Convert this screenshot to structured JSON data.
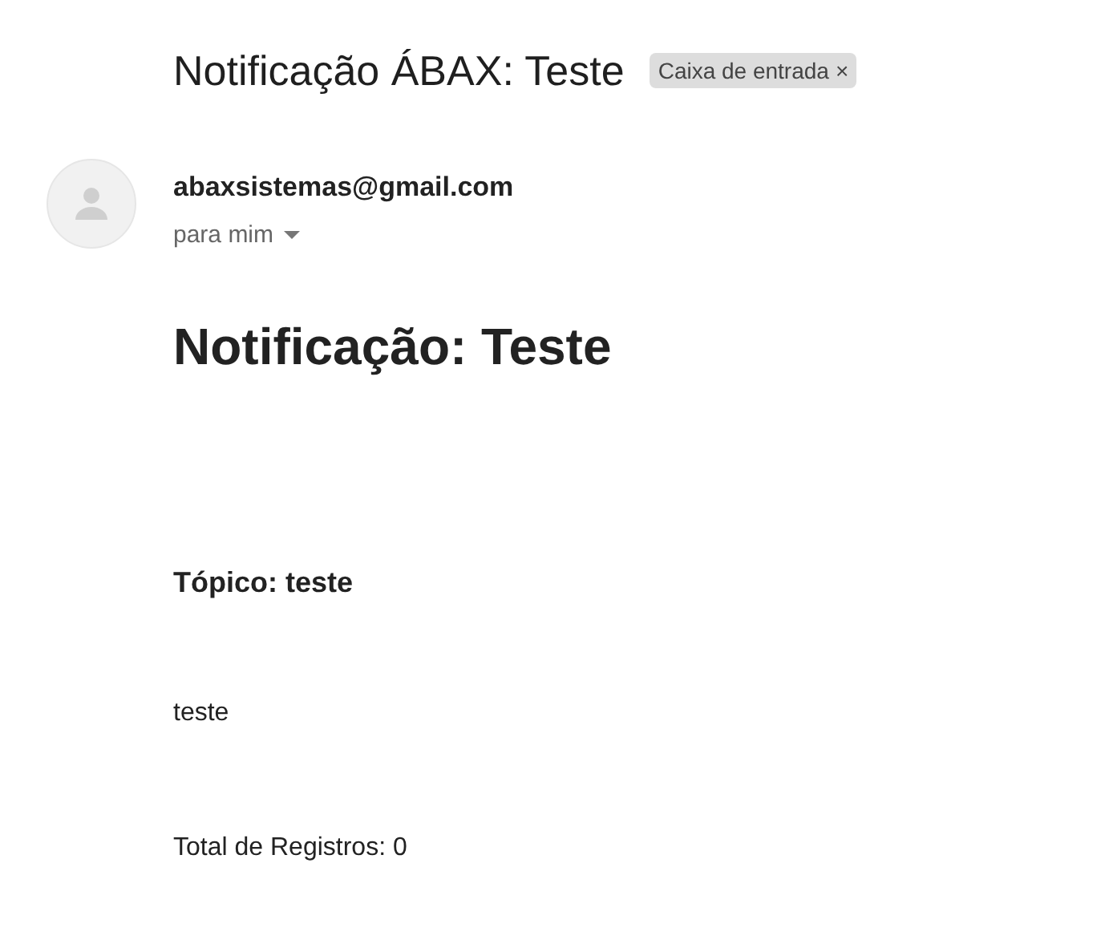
{
  "subject": "Notificação ÁBAX: Teste",
  "label": {
    "text": "Caixa de entrada",
    "remove": "×"
  },
  "sender": {
    "email": "abaxsistemas@gmail.com",
    "recipient": "para mim"
  },
  "body": {
    "heading": "Notificação: Teste",
    "topic": "Tópico: teste",
    "message": "teste",
    "total": "Total de Registros: 0"
  }
}
